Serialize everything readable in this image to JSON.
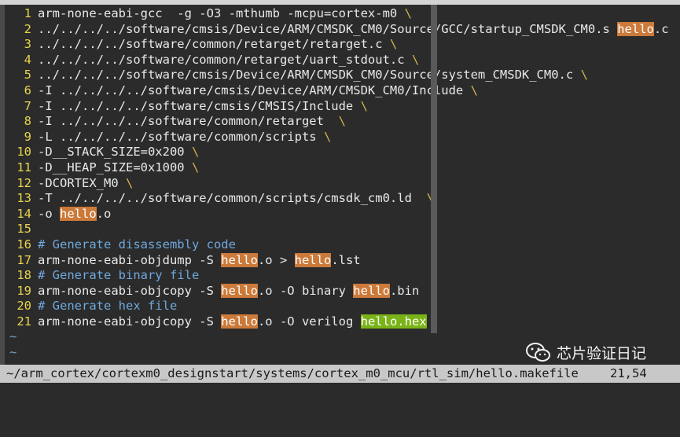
{
  "editor": {
    "lines": [
      {
        "n": "1",
        "segs": [
          {
            "t": "arm-none-eabi-gcc  -g -O3 -mthumb -mcpu=cortex-m0 ",
            "c": "code"
          },
          {
            "t": "\\",
            "c": "bs"
          }
        ]
      },
      {
        "n": "2",
        "segs": [
          {
            "t": "../../../../software/cmsis/Device/ARM/CMSDK_CM0/Source/GCC/startup_CMSDK_CM0.s ",
            "c": "code"
          },
          {
            "t": "hello",
            "c": "hl"
          },
          {
            "t": ".c",
            "c": "code"
          }
        ]
      },
      {
        "n": "3",
        "segs": [
          {
            "t": "../../../../software/common/retarget/retarget.c ",
            "c": "code"
          },
          {
            "t": "\\",
            "c": "bs"
          }
        ]
      },
      {
        "n": "4",
        "segs": [
          {
            "t": "../../../../software/common/retarget/uart_stdout.c ",
            "c": "code"
          },
          {
            "t": "\\",
            "c": "bs"
          }
        ]
      },
      {
        "n": "5",
        "segs": [
          {
            "t": "../../../../software/cmsis/Device/ARM/CMSDK_CM0/Source/system_CMSDK_CM0.c ",
            "c": "code"
          },
          {
            "t": "\\",
            "c": "bs"
          }
        ]
      },
      {
        "n": "6",
        "segs": [
          {
            "t": "-I ../../../../software/cmsis/Device/ARM/CMSDK_CM0/Include ",
            "c": "code"
          },
          {
            "t": "\\",
            "c": "bs"
          }
        ]
      },
      {
        "n": "7",
        "segs": [
          {
            "t": "-I ../../../../software/cmsis/CMSIS/Include ",
            "c": "code"
          },
          {
            "t": "\\",
            "c": "bs"
          }
        ]
      },
      {
        "n": "8",
        "segs": [
          {
            "t": "-I ../../../../software/common/retarget  ",
            "c": "code"
          },
          {
            "t": "\\",
            "c": "bs"
          }
        ]
      },
      {
        "n": "9",
        "segs": [
          {
            "t": "-L ../../../../software/common/scripts ",
            "c": "code"
          },
          {
            "t": "\\",
            "c": "bs"
          }
        ]
      },
      {
        "n": "10",
        "segs": [
          {
            "t": "-D__STACK_SIZE=0x200 ",
            "c": "code"
          },
          {
            "t": "\\",
            "c": "bs"
          }
        ]
      },
      {
        "n": "11",
        "segs": [
          {
            "t": "-D__HEAP_SIZE=0x1000 ",
            "c": "code"
          },
          {
            "t": "\\",
            "c": "bs"
          }
        ]
      },
      {
        "n": "12",
        "segs": [
          {
            "t": "-DCORTEX_M0 ",
            "c": "code"
          },
          {
            "t": "\\",
            "c": "bs"
          }
        ]
      },
      {
        "n": "13",
        "segs": [
          {
            "t": "-T ../../../../software/common/scripts/cmsdk_cm0.ld  ",
            "c": "code"
          },
          {
            "t": "\\",
            "c": "bs"
          }
        ]
      },
      {
        "n": "14",
        "segs": [
          {
            "t": "-o ",
            "c": "code"
          },
          {
            "t": "hello",
            "c": "hl"
          },
          {
            "t": ".o",
            "c": "code"
          }
        ]
      },
      {
        "n": "15",
        "segs": []
      },
      {
        "n": "16",
        "segs": [
          {
            "t": "# Generate disassembly code",
            "c": "comment"
          }
        ]
      },
      {
        "n": "17",
        "segs": [
          {
            "t": "arm-none-eabi-objdump -S ",
            "c": "code"
          },
          {
            "t": "hello",
            "c": "hl"
          },
          {
            "t": ".o > ",
            "c": "code"
          },
          {
            "t": "hello",
            "c": "hl"
          },
          {
            "t": ".lst",
            "c": "code"
          }
        ]
      },
      {
        "n": "18",
        "segs": [
          {
            "t": "# Generate binary file",
            "c": "comment"
          }
        ]
      },
      {
        "n": "19",
        "segs": [
          {
            "t": "arm-none-eabi-objcopy -S ",
            "c": "code"
          },
          {
            "t": "hello",
            "c": "hl"
          },
          {
            "t": ".o -O binary ",
            "c": "code"
          },
          {
            "t": "hello",
            "c": "hl"
          },
          {
            "t": ".bin",
            "c": "code"
          }
        ]
      },
      {
        "n": "20",
        "segs": [
          {
            "t": "# Generate hex file",
            "c": "comment"
          }
        ]
      },
      {
        "n": "21",
        "segs": [
          {
            "t": "arm-none-eabi-objcopy -S ",
            "c": "code"
          },
          {
            "t": "hello",
            "c": "hl"
          },
          {
            "t": ".o -O verilog ",
            "c": "code"
          },
          {
            "t": "hello.hex",
            "c": "hl2"
          }
        ]
      }
    ],
    "tildes": [
      "~",
      "~"
    ]
  },
  "status": {
    "file": "~/arm_cortex/cortexm0_designstart/systems/cortex_m0_mcu/rtl_sim/hello.makefile",
    "position": "21,54"
  },
  "watermark": {
    "text": "芯片验证日记",
    "icon": "wechat-icon"
  },
  "colors": {
    "background": "#2b2b2b",
    "line_number": "#e8d44d",
    "comment": "#6fa8dc",
    "search_highlight": "#cc7a3a",
    "current_match": "#7ab317",
    "status_bar": "#c8c8c8"
  }
}
